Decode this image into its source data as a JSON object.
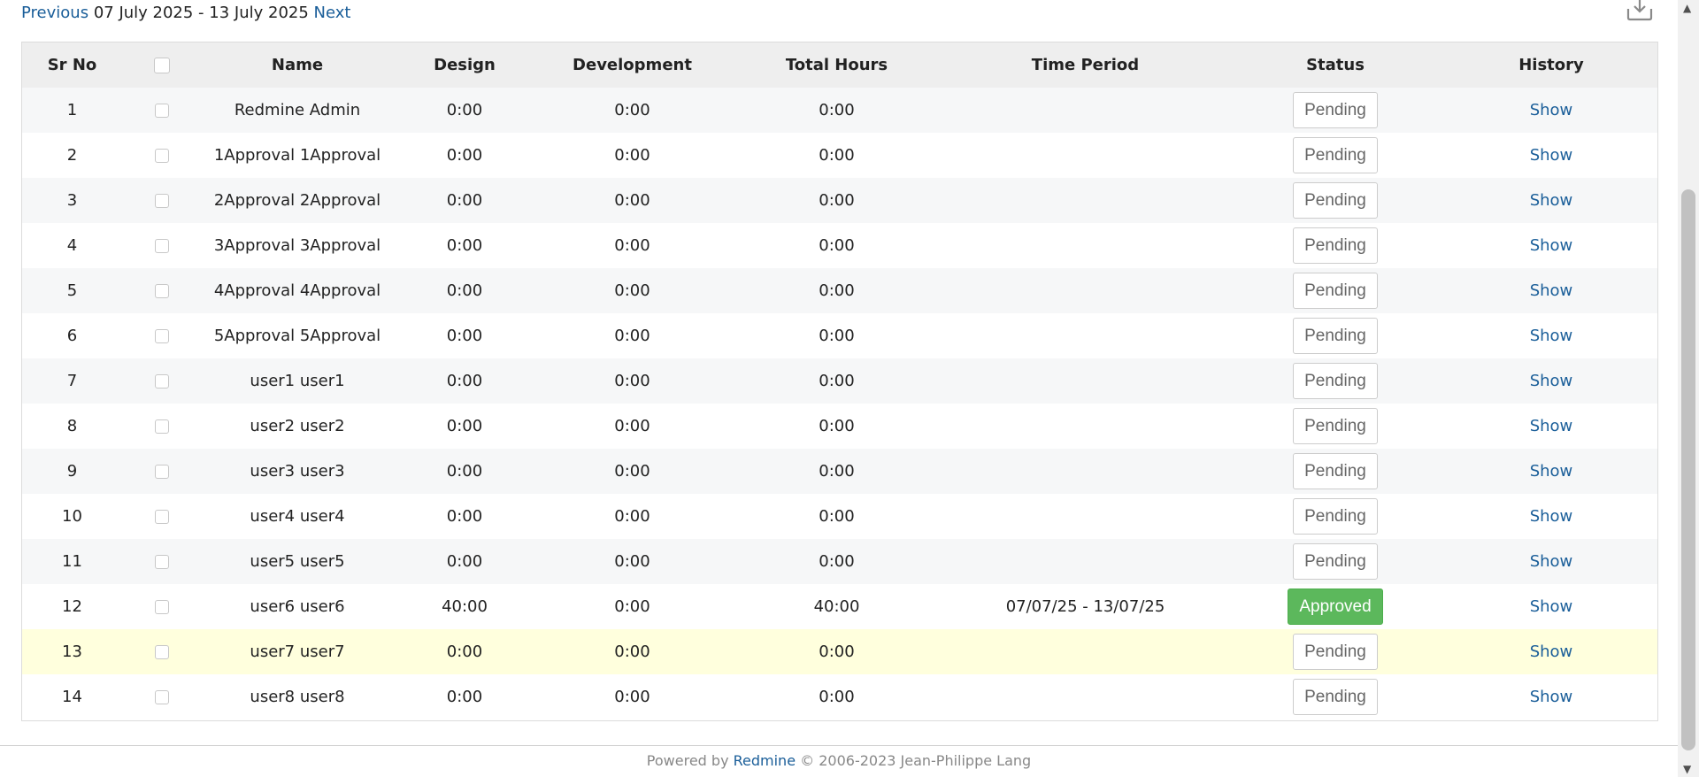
{
  "period_nav": {
    "previous_label": "Previous",
    "range_label": "07 July 2025 - 13 July 2025",
    "next_label": "Next"
  },
  "toolbar": {
    "export_icon": "download-tray-icon"
  },
  "table": {
    "headers": [
      "Sr No",
      "",
      "Name",
      "Design",
      "Development",
      "Total Hours",
      "Time Period",
      "Status",
      "History"
    ],
    "rows": [
      {
        "sr": "1",
        "name": "Redmine Admin",
        "design": "0:00",
        "development": "0:00",
        "total": "0:00",
        "period": "",
        "status": "Pending",
        "history": "Show"
      },
      {
        "sr": "2",
        "name": "1Approval 1Approval",
        "design": "0:00",
        "development": "0:00",
        "total": "0:00",
        "period": "",
        "status": "Pending",
        "history": "Show"
      },
      {
        "sr": "3",
        "name": "2Approval 2Approval",
        "design": "0:00",
        "development": "0:00",
        "total": "0:00",
        "period": "",
        "status": "Pending",
        "history": "Show"
      },
      {
        "sr": "4",
        "name": "3Approval 3Approval",
        "design": "0:00",
        "development": "0:00",
        "total": "0:00",
        "period": "",
        "status": "Pending",
        "history": "Show"
      },
      {
        "sr": "5",
        "name": "4Approval 4Approval",
        "design": "0:00",
        "development": "0:00",
        "total": "0:00",
        "period": "",
        "status": "Pending",
        "history": "Show"
      },
      {
        "sr": "6",
        "name": "5Approval 5Approval",
        "design": "0:00",
        "development": "0:00",
        "total": "0:00",
        "period": "",
        "status": "Pending",
        "history": "Show"
      },
      {
        "sr": "7",
        "name": "user1 user1",
        "design": "0:00",
        "development": "0:00",
        "total": "0:00",
        "period": "",
        "status": "Pending",
        "history": "Show"
      },
      {
        "sr": "8",
        "name": "user2 user2",
        "design": "0:00",
        "development": "0:00",
        "total": "0:00",
        "period": "",
        "status": "Pending",
        "history": "Show"
      },
      {
        "sr": "9",
        "name": "user3 user3",
        "design": "0:00",
        "development": "0:00",
        "total": "0:00",
        "period": "",
        "status": "Pending",
        "history": "Show"
      },
      {
        "sr": "10",
        "name": "user4 user4",
        "design": "0:00",
        "development": "0:00",
        "total": "0:00",
        "period": "",
        "status": "Pending",
        "history": "Show"
      },
      {
        "sr": "11",
        "name": "user5 user5",
        "design": "0:00",
        "development": "0:00",
        "total": "0:00",
        "period": "",
        "status": "Pending",
        "history": "Show"
      },
      {
        "sr": "12",
        "name": "user6 user6",
        "design": "40:00",
        "development": "0:00",
        "total": "40:00",
        "period": "07/07/25 - 13/07/25",
        "status": "Approved",
        "history": "Show"
      },
      {
        "sr": "13",
        "name": "user7 user7",
        "design": "0:00",
        "development": "0:00",
        "total": "0:00",
        "period": "",
        "status": "Pending",
        "history": "Show",
        "highlighted": true
      },
      {
        "sr": "14",
        "name": "user8 user8",
        "design": "0:00",
        "development": "0:00",
        "total": "0:00",
        "period": "",
        "status": "Pending",
        "history": "Show"
      }
    ]
  },
  "colors": {
    "approved": "#5cb85c",
    "link": "#1a5e99",
    "highlight_row": "#ffffdd"
  },
  "footer": {
    "powered_by": "Powered by",
    "link_label": "Redmine",
    "copyright": "© 2006-2023 Jean-Philippe Lang"
  }
}
